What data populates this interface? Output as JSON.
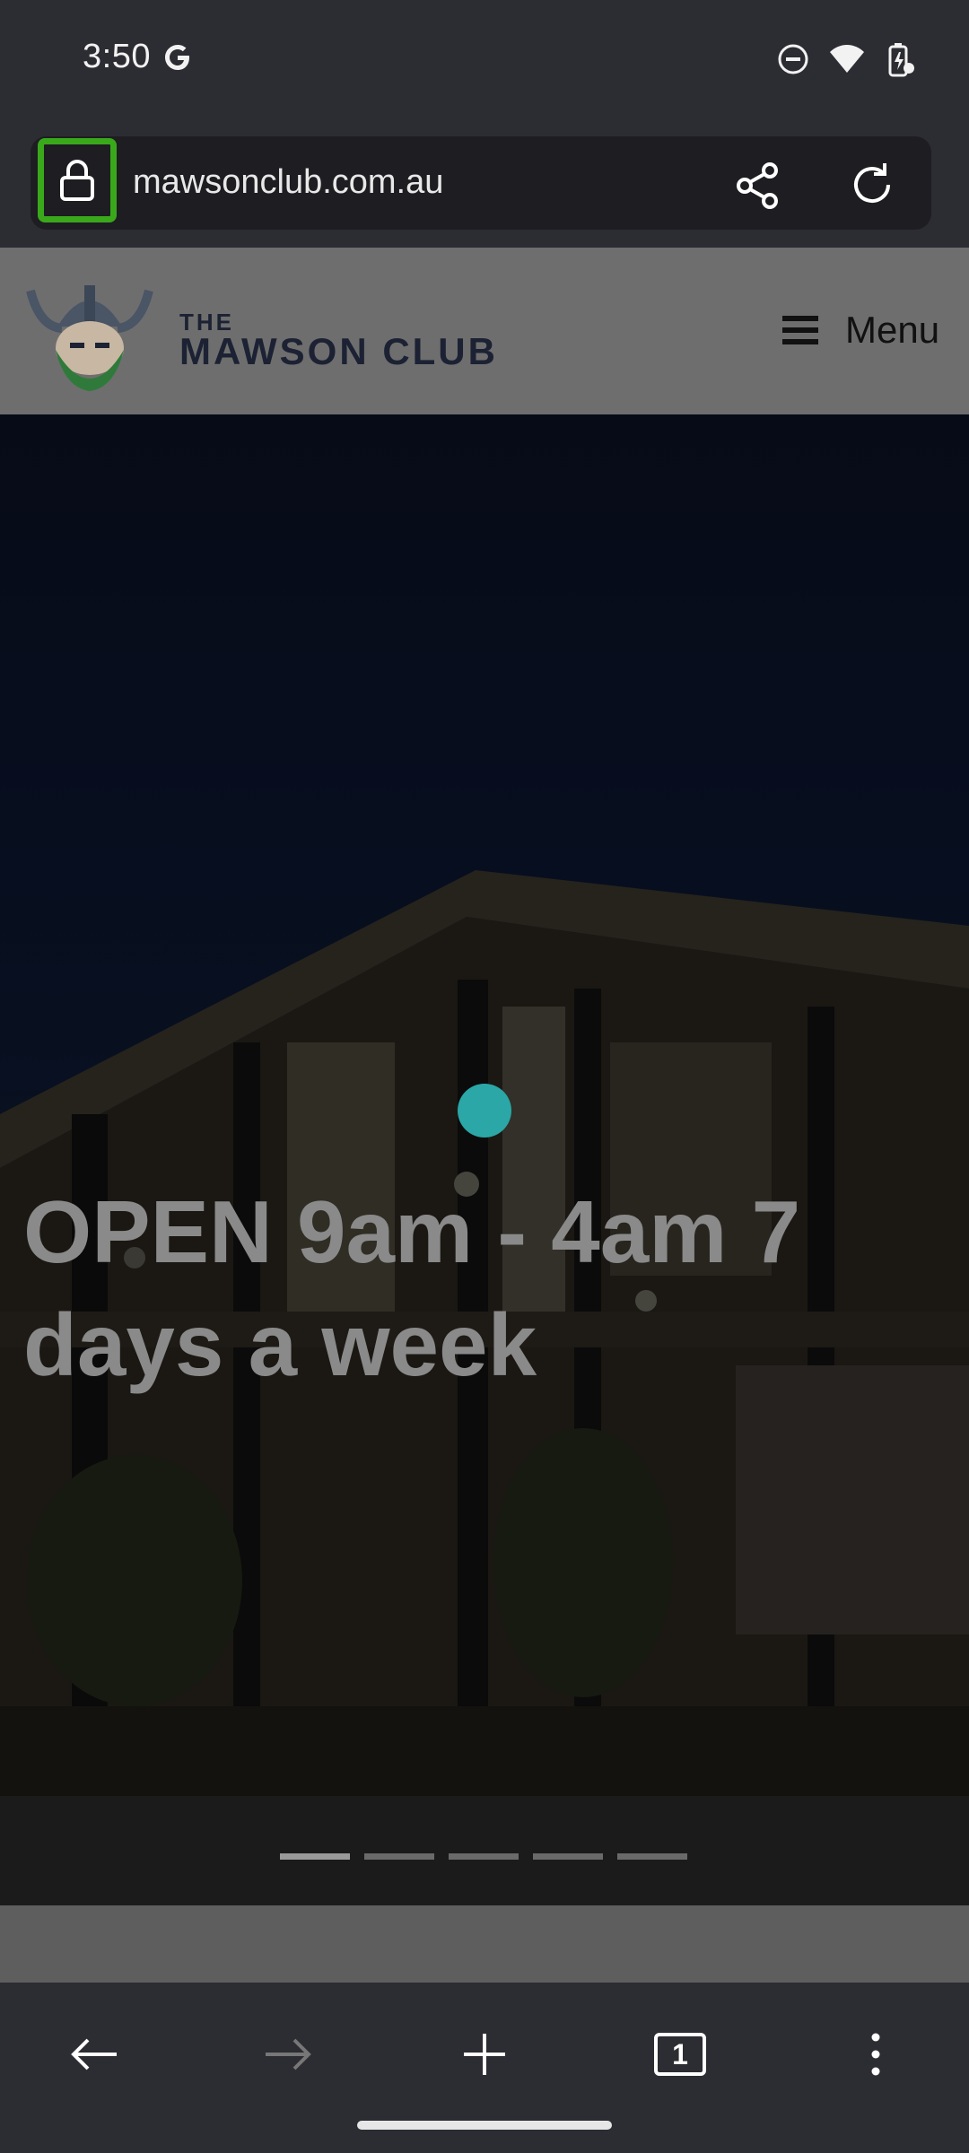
{
  "status_bar": {
    "time": "3:50",
    "icons": [
      "google-g-icon",
      "do-not-disturb-icon",
      "wifi-icon",
      "battery-charging-icon"
    ]
  },
  "browser": {
    "url": "mawsonclub.com.au",
    "tab_count": "1",
    "accent_color": "#3aa81b"
  },
  "site": {
    "logo_the": "THE",
    "logo_name": "MAWSON CLUB",
    "menu_label": "Menu"
  },
  "hero": {
    "title": "OPEN 9am - 4am 7 days a week",
    "slide_count": 5,
    "active_slide": 1
  },
  "nav": {
    "icons": [
      "back-arrow-icon",
      "forward-arrow-icon",
      "new-tab-plus-icon",
      "tabs-switcher-icon",
      "more-vert-icon"
    ]
  }
}
